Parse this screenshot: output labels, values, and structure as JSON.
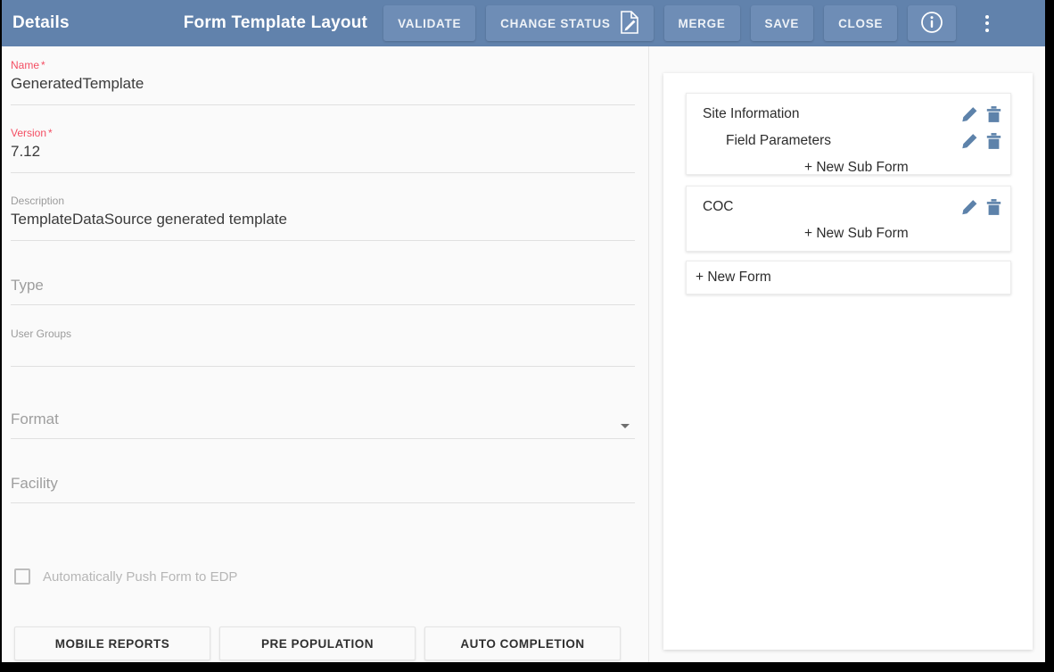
{
  "appbar": {
    "details_title": "Details",
    "main_title": "Form Template Layout",
    "buttons": [
      {
        "label": "VALIDATE",
        "icon": null
      },
      {
        "label": "CHANGE STATUS",
        "icon": "document-edit-icon"
      },
      {
        "label": "MERGE",
        "icon": null
      },
      {
        "label": "SAVE",
        "icon": null
      },
      {
        "label": "CLOSE",
        "icon": null
      }
    ],
    "info_icon": "info-circle-icon",
    "overflow_icon": "more-vertical-icon",
    "bar_color": "#6182ac",
    "button_color": "#6e8db6"
  },
  "form": {
    "fields": [
      {
        "label": "Name",
        "required": true,
        "value": "GeneratedTemplate",
        "placeholder": ""
      },
      {
        "label": "Version",
        "required": true,
        "value": "7.12",
        "placeholder": ""
      },
      {
        "label": "Description",
        "required": false,
        "value": "TemplateDataSource generated template",
        "placeholder": ""
      },
      {
        "label": "Type",
        "required": false,
        "value": "",
        "placeholder": "Type"
      },
      {
        "label": "User Groups",
        "required": false,
        "value": "",
        "placeholder": ""
      },
      {
        "label": "Format",
        "required": false,
        "value": "",
        "placeholder": "Format"
      },
      {
        "label": "Facility",
        "required": false,
        "value": "",
        "placeholder": "Facility"
      }
    ],
    "required_color": "#f44e63",
    "push_checkbox": {
      "label": "Automatically Push Form to EDP",
      "checked": false
    },
    "bottom_buttons": [
      {
        "label": "MOBILE REPORTS"
      },
      {
        "label": "PRE POPULATION"
      },
      {
        "label": "AUTO COMPLETION"
      }
    ]
  },
  "forms_panel": {
    "icon_color": "#5d82aa",
    "cards": [
      {
        "name": "Site Information",
        "edit_icon": "pencil-icon",
        "delete_icon": "trash-icon",
        "subform": {
          "name": "Field Parameters",
          "edit_icon": "pencil-icon",
          "delete_icon": "trash-icon"
        },
        "new_sub_form_label": "+ New Sub Form"
      },
      {
        "name": "COC",
        "edit_icon": "pencil-icon",
        "delete_icon": "trash-icon",
        "subform": null,
        "new_sub_form_label": "+ New Sub Form"
      }
    ],
    "new_form_label": "+ New Form"
  }
}
